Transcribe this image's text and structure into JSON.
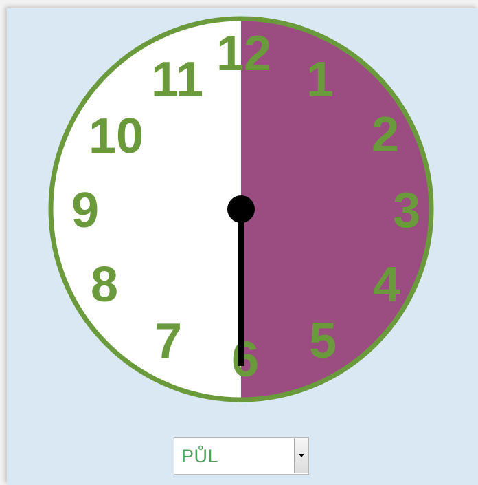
{
  "clock": {
    "numbers": [
      "12",
      "1",
      "2",
      "3",
      "4",
      "5",
      "6",
      "7",
      "8",
      "9",
      "10",
      "11"
    ],
    "hand_minutes": 30,
    "colors": {
      "face": "#ffffff",
      "filled_sector": "#9b4c80",
      "rim": "#6a9a3c",
      "numbers": "#6a9a3c",
      "hand": "#000000"
    }
  },
  "time_select": {
    "selected_value": "PŮL"
  }
}
